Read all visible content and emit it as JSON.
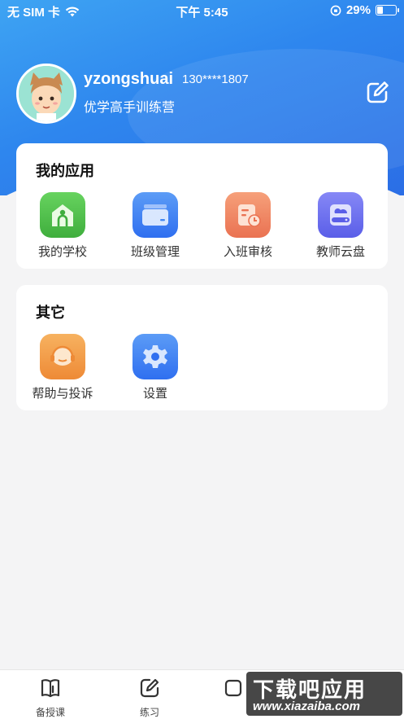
{
  "status": {
    "carrier": "无 SIM 卡",
    "time": "下午 5:45",
    "battery": "29%",
    "battery_level": 0.29
  },
  "profile": {
    "username": "yzongshuai",
    "phone": "130****1807",
    "org": "优学高手训练营"
  },
  "apps_card": {
    "title": "我的应用",
    "items": [
      {
        "label": "我的学校",
        "icon": "school-icon",
        "color": "#4ec04a"
      },
      {
        "label": "班级管理",
        "icon": "class-folder-icon",
        "color": "#3f86f2"
      },
      {
        "label": "入班审核",
        "icon": "review-document-icon",
        "color": "#f08a63"
      },
      {
        "label": "教师云盘",
        "icon": "cloud-drive-icon",
        "color": "#6b6fee"
      }
    ]
  },
  "other_card": {
    "title": "其它",
    "items": [
      {
        "label": "帮助与投诉",
        "icon": "headset-support-icon",
        "color": "#f2a04a"
      },
      {
        "label": "设置",
        "icon": "settings-gear-icon",
        "color": "#3f86f2"
      }
    ]
  },
  "tabbar": {
    "items": [
      {
        "label": "备授课",
        "icon": "book-icon"
      },
      {
        "label": "练习",
        "icon": "edit-icon"
      }
    ]
  },
  "watermark": {
    "title": "下载吧应用",
    "url": "www.xiazaiba.com"
  }
}
